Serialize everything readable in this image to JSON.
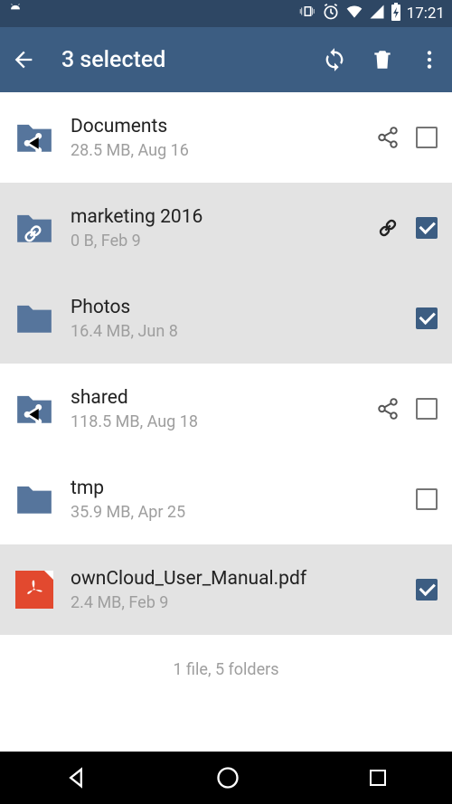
{
  "status": {
    "time": "17:21"
  },
  "appbar": {
    "title": "3 selected"
  },
  "files": [
    {
      "name": "Documents",
      "meta": "28.5 MB, Aug 16",
      "type": "folder",
      "folderBadge": "share",
      "selected": false,
      "trailingIcon": "share"
    },
    {
      "name": "marketing 2016",
      "meta": "0 B, Feb 9",
      "type": "folder",
      "folderBadge": "link",
      "selected": true,
      "trailingIcon": "link"
    },
    {
      "name": "Photos",
      "meta": "16.4 MB, Jun 8",
      "type": "folder",
      "folderBadge": null,
      "selected": true,
      "trailingIcon": null
    },
    {
      "name": "shared",
      "meta": "118.5 MB, Aug 18",
      "type": "folder",
      "folderBadge": "share",
      "selected": false,
      "trailingIcon": "share"
    },
    {
      "name": "tmp",
      "meta": "35.9 MB, Apr 25",
      "type": "folder",
      "folderBadge": null,
      "selected": false,
      "trailingIcon": null
    },
    {
      "name": "ownCloud_User_Manual.pdf",
      "meta": "2.4 MB, Feb 9",
      "type": "pdf",
      "folderBadge": null,
      "selected": true,
      "trailingIcon": null
    }
  ],
  "summary": "1 file, 5 folders",
  "colors": {
    "primary": "#3c5d82",
    "folderFill": "#56759c"
  }
}
